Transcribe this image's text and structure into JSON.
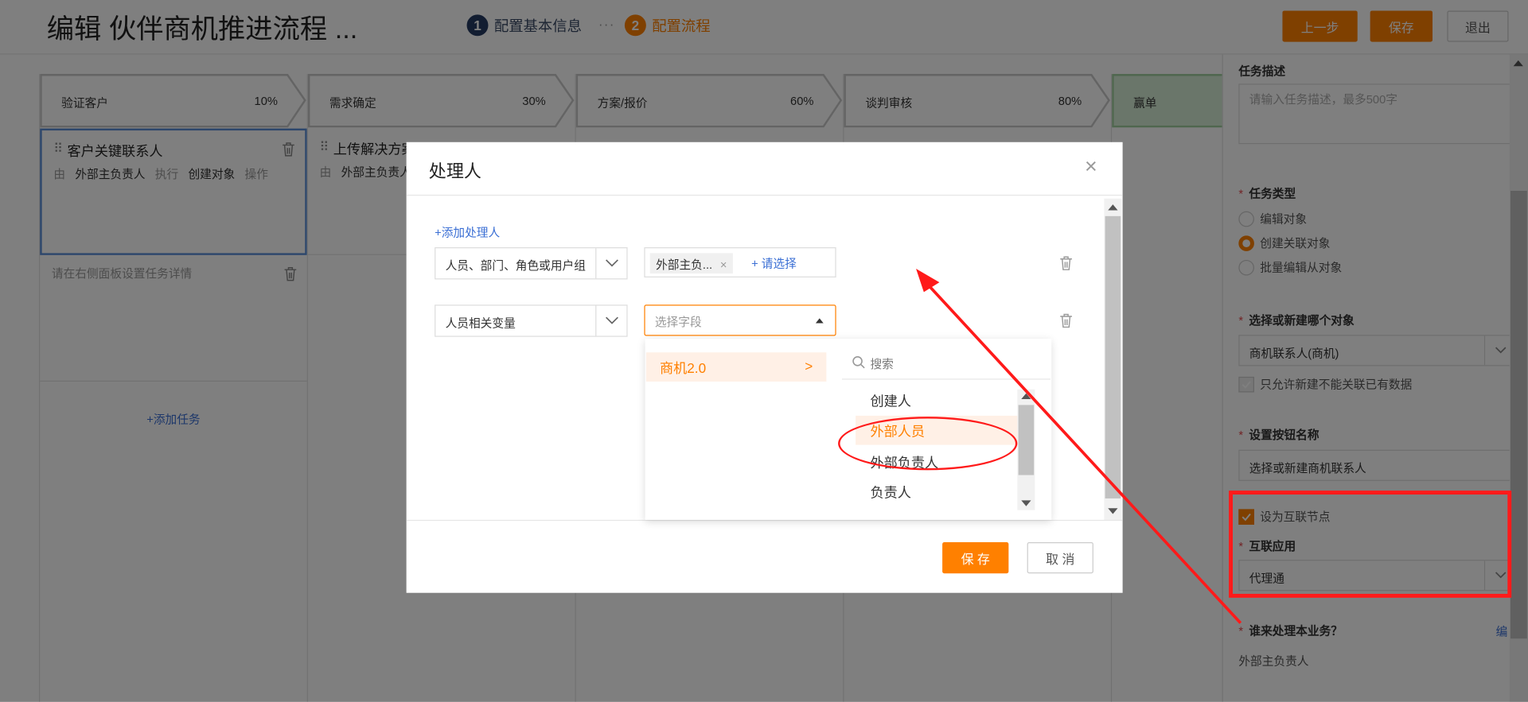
{
  "header": {
    "title": "编辑 伙伴商机推进流程 ...",
    "steps": [
      {
        "num": "1",
        "label": "配置基本信息"
      },
      {
        "num": "2",
        "label": "配置流程"
      }
    ],
    "step_sep": "···",
    "prev_label": "上一步",
    "save_label": "保存",
    "exit_label": "退出"
  },
  "stages": [
    {
      "name": "验证客户",
      "pct": "10%"
    },
    {
      "name": "需求确定",
      "pct": "30%"
    },
    {
      "name": "方案/报价",
      "pct": "60%"
    },
    {
      "name": "谈判审核",
      "pct": "80%"
    },
    {
      "name": "赢单",
      "pct": ""
    }
  ],
  "task1": {
    "name": "客户关键联系人",
    "by": "由",
    "owner": "外部主负责人",
    "exec": "执行",
    "action": "创建对象",
    "op": "操作"
  },
  "task_col2": {
    "name": "上传解决方案",
    "by": "由",
    "owner": "外部主负责人"
  },
  "task_hint": "请在右侧面板设置任务详情",
  "add_task": "+添加任务",
  "right_panel": {
    "desc_label": "任务描述",
    "desc_placeholder": "请输入任务描述，最多500字",
    "type_label": "任务类型",
    "type_options": [
      "编辑对象",
      "创建关联对象",
      "批量编辑从对象"
    ],
    "type_selected": "创建关联对象",
    "object_label": "选择或新建哪个对象",
    "object_value": "商机联系人(商机)",
    "only_new_label": "只允许新建不能关联已有数据",
    "button_name_label": "设置按钮名称",
    "button_name_value": "选择或新建商机联系人",
    "interconnect_label": "设为互联节点",
    "app_label": "互联应用",
    "app_value": "代理通",
    "handler_label": "谁来处理本业务？",
    "handler_edit": "编",
    "handler_value": "外部主负责人",
    "required_mark": "*"
  },
  "modal": {
    "title": "处理人",
    "close": "×",
    "add_handler": "+添加处理人",
    "row1_type": "人员、部门、角色或用户组",
    "row1_tag": "外部主负...",
    "row1_tag_close": "×",
    "row1_pick": "+ 请选择",
    "row2_type": "人员相关变量",
    "row2_placeholder": "选择字段",
    "ok_label": "保 存",
    "cancel_label": "取 消"
  },
  "dropdown": {
    "object": "商机2.0",
    "search_placeholder": "搜索",
    "options": [
      "创建人",
      "外部人员",
      "外部负责人",
      "负责人"
    ],
    "highlighted": "外部人员"
  },
  "colors": {
    "accent": "#ff8000",
    "link": "#3b6fd4",
    "annotation": "#ff1a1a",
    "stage_done": "#d5ecd4"
  }
}
